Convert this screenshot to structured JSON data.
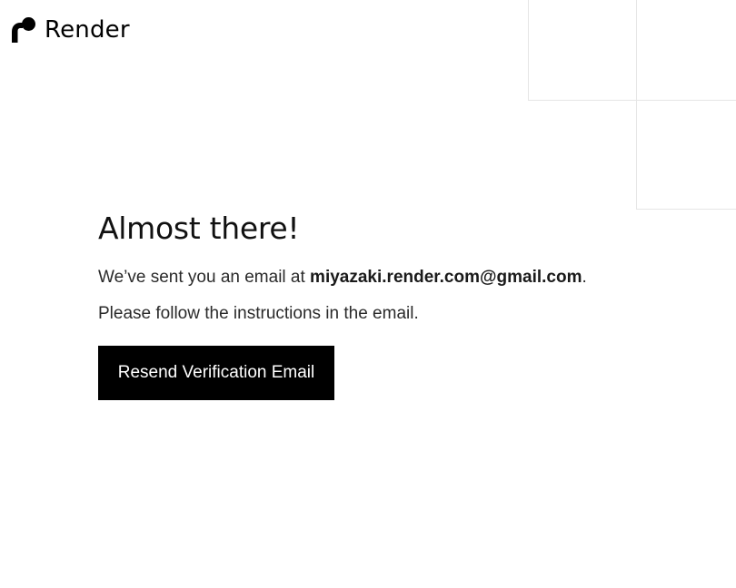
{
  "brand": {
    "name": "Render",
    "logo_icon": "render-logo-mark"
  },
  "verify": {
    "headline": "Almost there!",
    "sent_prefix": "We’ve sent you an email at ",
    "email": "miyazaki.render.com@gmail.com",
    "sent_suffix": ".",
    "instructions": "Please follow the instructions in the email.",
    "resend_label": "Resend Verification Email"
  },
  "colors": {
    "background": "#ffffff",
    "text": "#1a1a1a",
    "button_bg": "#000000",
    "button_text": "#ffffff",
    "decor_line": "#e6e6e6"
  }
}
